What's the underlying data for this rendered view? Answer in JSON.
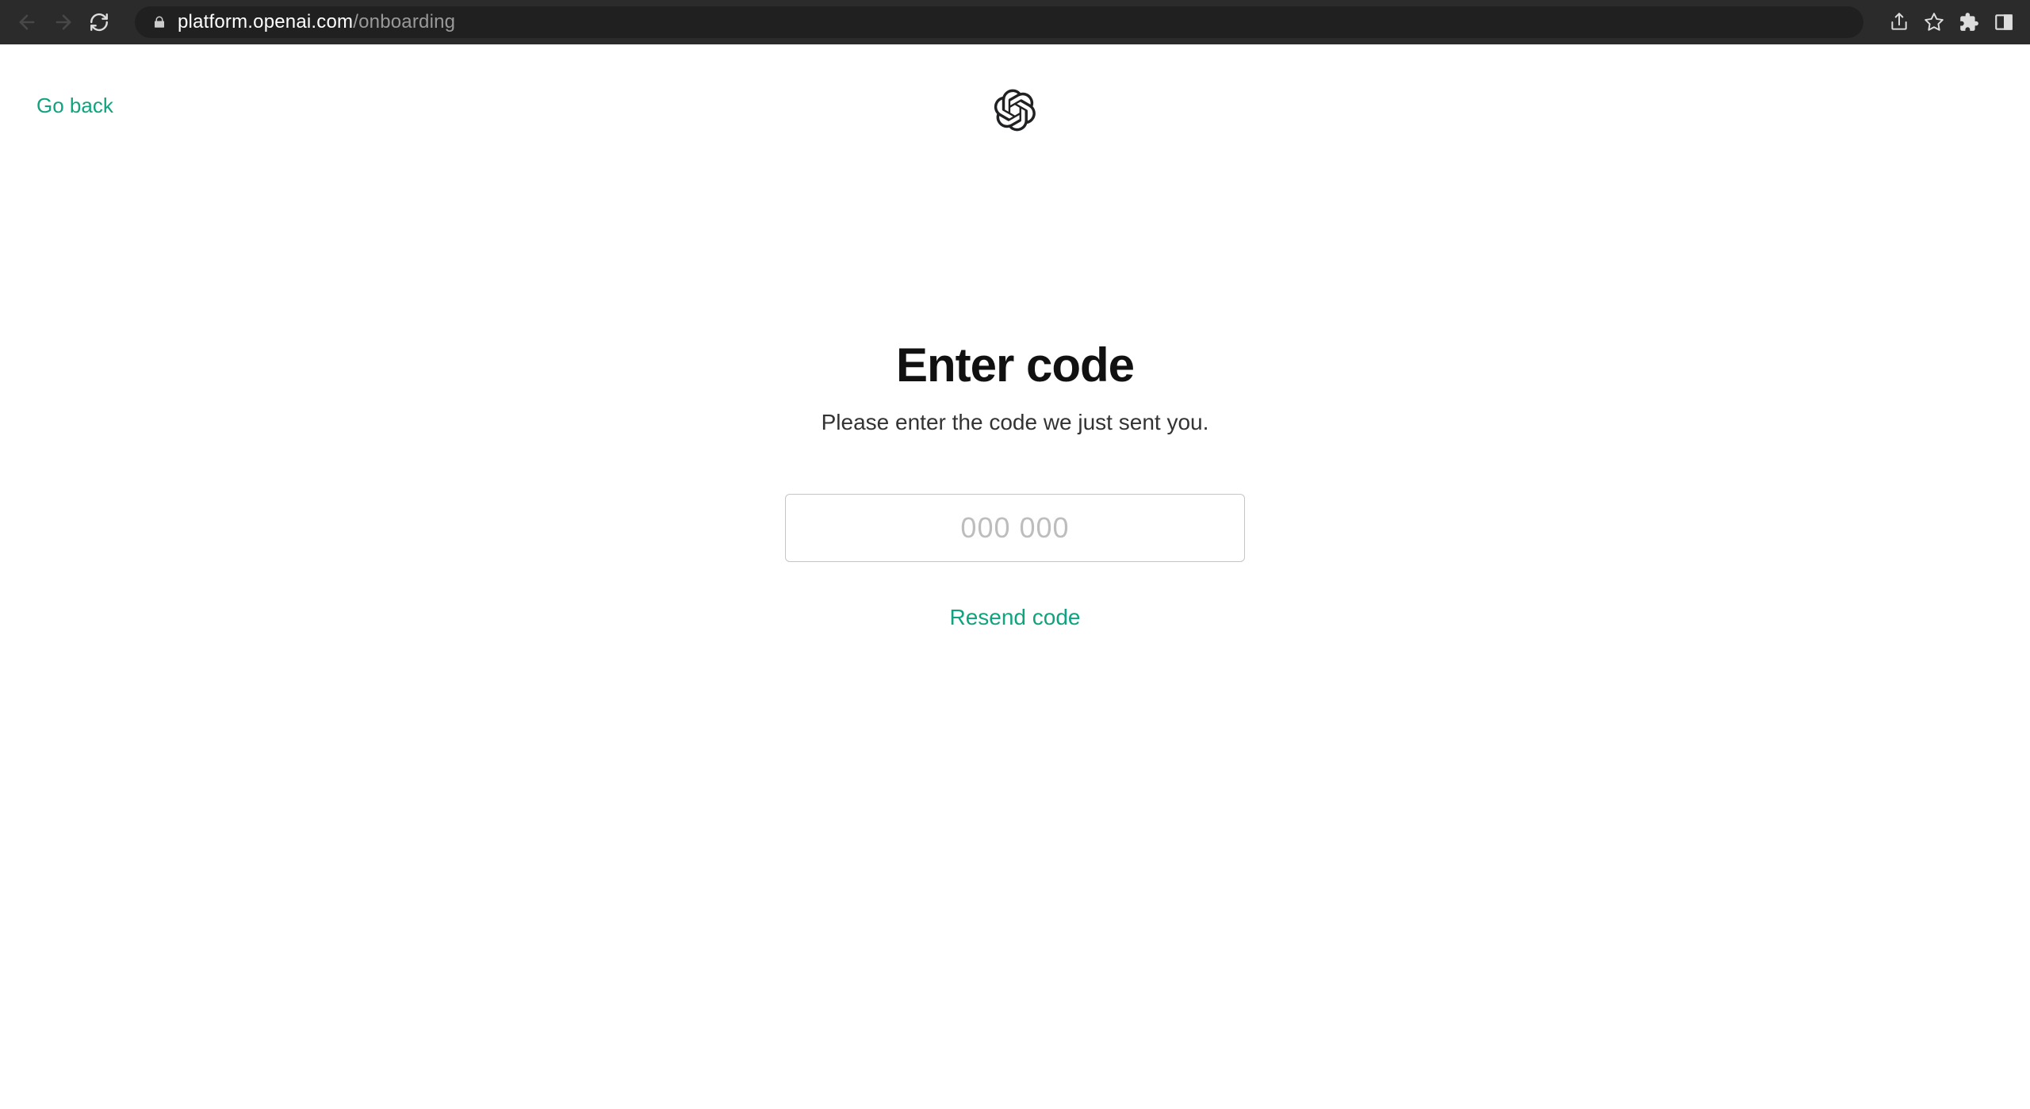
{
  "browser": {
    "url_domain": "platform.openai.com",
    "url_path": "/onboarding"
  },
  "page": {
    "go_back": "Go back",
    "title": "Enter code",
    "subtitle": "Please enter the code we just sent you.",
    "code_placeholder": "000 000",
    "code_value": "",
    "resend": "Resend code"
  }
}
